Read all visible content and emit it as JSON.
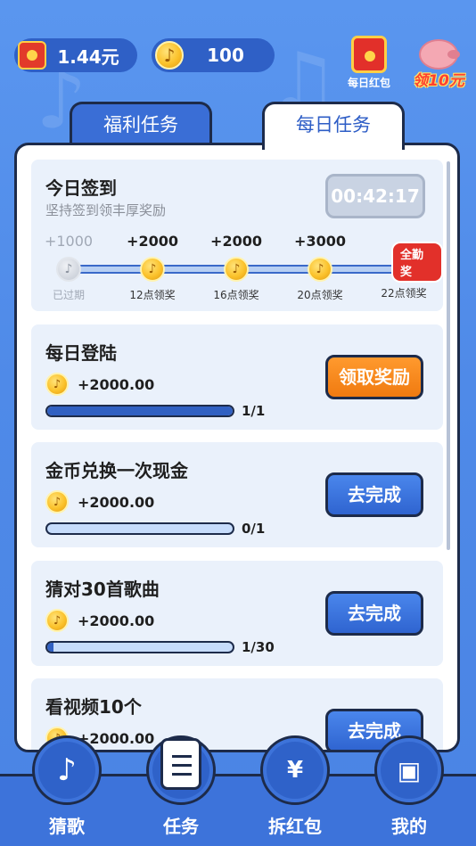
{
  "colors": {
    "background": "#5a96ef",
    "primary_blue": "#3060c2",
    "orange_button": "#ff9a2e",
    "red_accent": "#e2302a",
    "card_bg": "#eaf1fb"
  },
  "top_bar": {
    "redpack_balance": "1.44元",
    "coin_balance": "100",
    "daily_redpack_label": "每日红包",
    "claim_label": "领10元"
  },
  "tabs": [
    {
      "label": "福利任务",
      "active": false
    },
    {
      "label": "每日任务",
      "active": true
    }
  ],
  "checkin": {
    "title": "今日签到",
    "subtitle": "坚持签到领丰厚奖励",
    "countdown": "00:42:17",
    "full_attendance_badge": "全勤奖",
    "steps": [
      {
        "amount": "+1000",
        "caption": "已过期",
        "expired": true
      },
      {
        "amount": "+2000",
        "caption": "12点领奖",
        "expired": false
      },
      {
        "amount": "+2000",
        "caption": "16点领奖",
        "expired": false
      },
      {
        "amount": "+3000",
        "caption": "20点领奖",
        "expired": false
      },
      {
        "amount": "",
        "caption": "22点领奖",
        "expired": false
      }
    ]
  },
  "tasks": [
    {
      "title": "每日登陆",
      "reward": "+2000.00",
      "progress_text": "1/1",
      "progress": 1.0,
      "button": "领取奖励",
      "button_style": "orange"
    },
    {
      "title": "金币兑换一次现金",
      "reward": "+2000.00",
      "progress_text": "0/1",
      "progress": 0.0,
      "button": "去完成",
      "button_style": "blue"
    },
    {
      "title": "猜对30首歌曲",
      "reward": "+2000.00",
      "progress_text": "1/30",
      "progress": 0.033,
      "button": "去完成",
      "button_style": "blue"
    },
    {
      "title": "看视频10个",
      "reward": "+2000.00",
      "progress_text": "",
      "progress": 0.0,
      "button": "去完成",
      "button_style": "blue"
    }
  ],
  "bottom_nav": [
    {
      "label": "猜歌",
      "icon": "music-note-icon"
    },
    {
      "label": "任务",
      "icon": "clipboard-icon"
    },
    {
      "label": "拆红包",
      "icon": "redpack-icon"
    },
    {
      "label": "我的",
      "icon": "wallet-icon"
    }
  ]
}
